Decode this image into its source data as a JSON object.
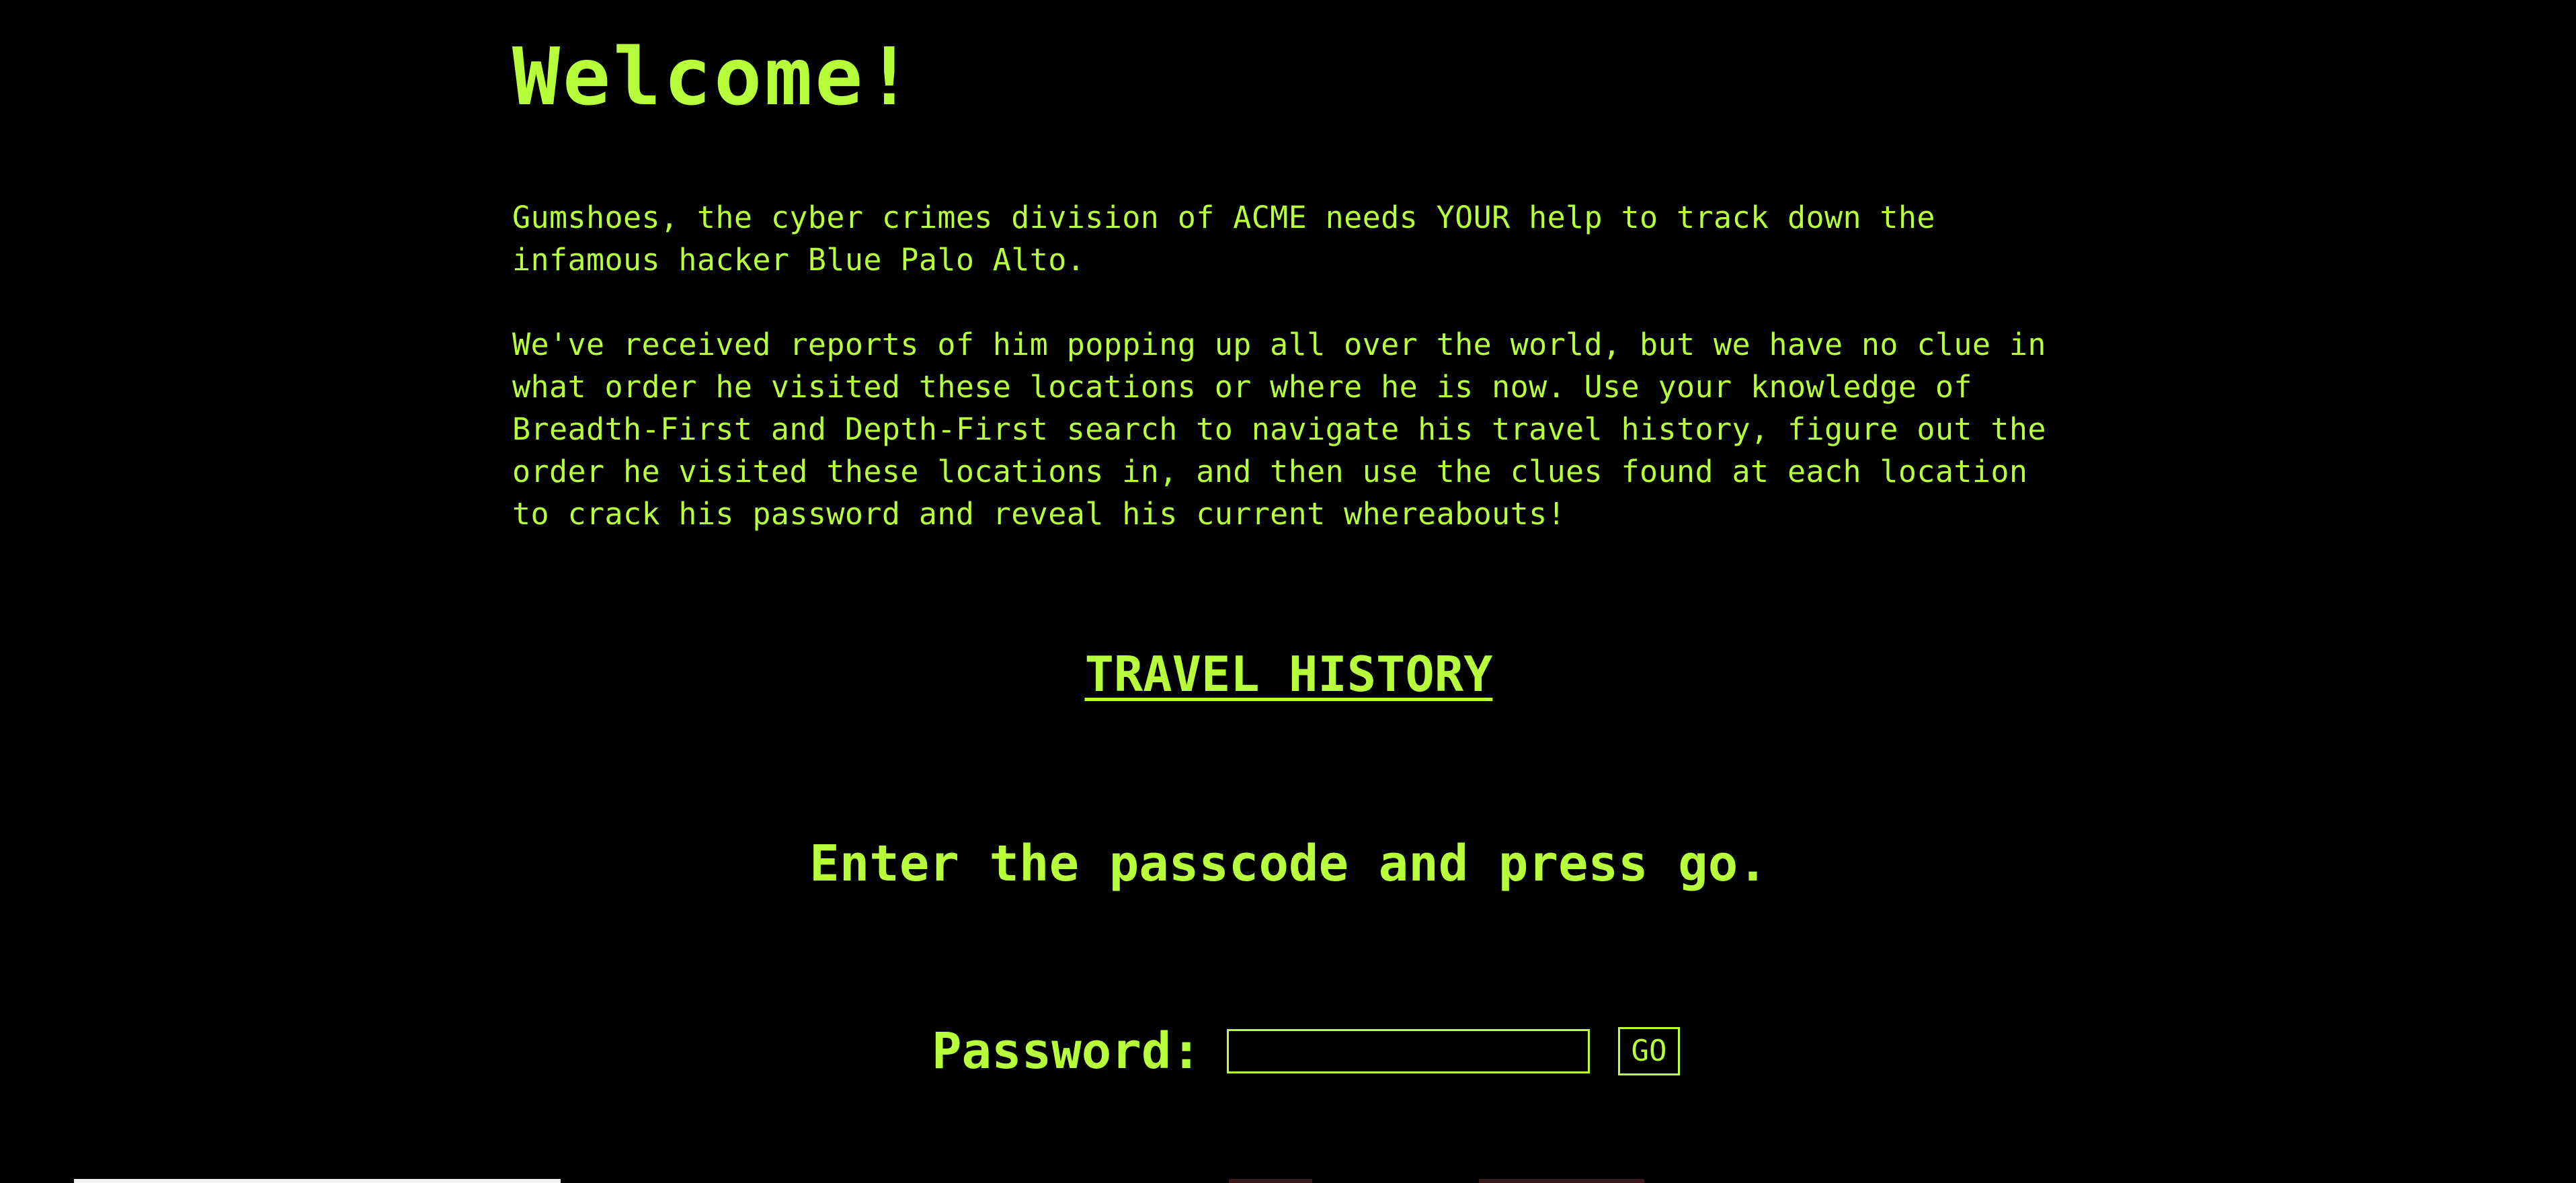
{
  "page": {
    "heading": "Welcome!",
    "intro_paragraph_1": "Gumshoes, the cyber crimes division of ACME needs YOUR help to track down the infamous hacker Blue Palo Alto.",
    "intro_paragraph_2": "We've received reports of him popping up all over the world, but we have no clue in what order he visited these locations or where he is now. Use your knowledge of Breadth-First and Depth-First search to navigate his travel history, figure out the order he visited these locations in, and then use the clues found at each location to crack his password and reveal his current whereabouts!",
    "travel_history_link": "TRAVEL HISTORY",
    "instructions": "Enter the passcode and press go."
  },
  "password_form": {
    "label": "Password:",
    "value": "",
    "placeholder": "",
    "go_label": "GO"
  },
  "colors": {
    "background": "#000000",
    "text": "#b6ff3a"
  }
}
